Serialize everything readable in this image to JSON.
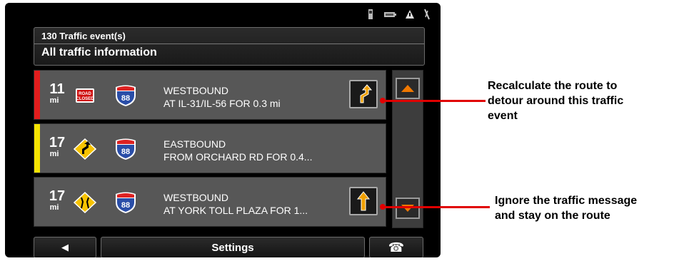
{
  "header": {
    "event_count": "130 Traffic event(s)",
    "title": "All traffic information"
  },
  "events": [
    {
      "bar_color": "#e21d1d",
      "distance": "11",
      "unit": "mi",
      "icon": "road-closed-sign",
      "road_shield": "88",
      "line1": "WESTBOUND",
      "line2": "AT IL-31/IL-56 FOR 0.3 mi",
      "action": "detour-icon"
    },
    {
      "bar_color": "#f4e300",
      "distance": "17",
      "unit": "mi",
      "icon": "lane-shift-sign",
      "road_shield": "88",
      "line1": "EASTBOUND",
      "line2": "FROM ORCHARD RD FOR 0.4..."
    },
    {
      "bar_color": "#575757",
      "distance": "17",
      "unit": "mi",
      "icon": "road-narrows-sign",
      "road_shield": "88",
      "line1": "WESTBOUND",
      "line2": "AT YORK TOLL PLAZA FOR 1...",
      "action": "straight-arrow-icon"
    }
  ],
  "bottom_bar": {
    "back": "◀",
    "settings": "Settings",
    "call": "☎"
  },
  "annotations": {
    "recalculate": [
      "Recalculate the route to",
      "detour around this traffic",
      "event"
    ],
    "ignore": [
      "Ignore the traffic message",
      "and stay on the route"
    ]
  },
  "colors": {
    "accent_orange": "#f0a000",
    "callout_red": "#e10000"
  }
}
